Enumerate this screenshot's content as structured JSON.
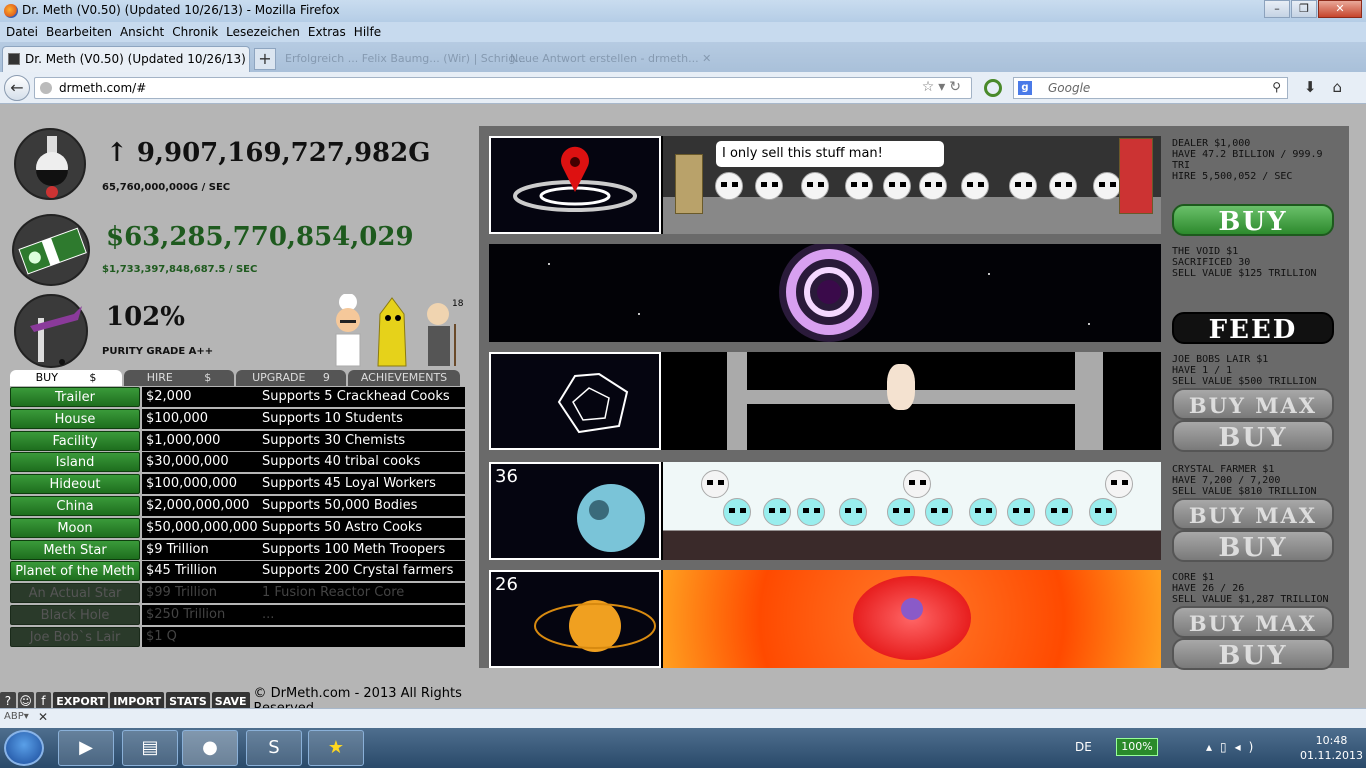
{
  "window": {
    "title": "Dr. Meth (V0.50) (Updated 10/26/13) - Mozilla Firefox",
    "controls": [
      "–",
      "❐",
      "✕"
    ]
  },
  "menu": [
    "Datei",
    "Bearbeiten",
    "Ansicht",
    "Chronik",
    "Lesezeichen",
    "Extras",
    "Hilfe"
  ],
  "tab": {
    "title": "Dr. Meth (V0.50) (Updated 10/26/13)",
    "new": "+"
  },
  "bg_tabs": [
    "Erfolgreich ... Felix Baumg... (Wir) | Schrig...",
    "Neue Antwort erstellen - drmeth... ✕"
  ],
  "nav": {
    "url": "drmeth.com/#",
    "search_placeholder": "Google",
    "search_engine": "g"
  },
  "stats": {
    "meth": "↑ 9,907,169,727,982G",
    "meth_rate": "65,760,000,000G / SEC",
    "cash": "$63,285,770,854,029",
    "cash_rate": "$1,733,397,848,687.5 / SEC",
    "purity": "102%",
    "purity_grade": "PURITY GRADE A++",
    "badge": "18"
  },
  "shop_tabs": [
    "BUY",
    "$",
    "HIRE",
    "$",
    "UPGRADE",
    "9",
    "ACHIEVEMENTS"
  ],
  "shop": [
    {
      "name": "Trailer",
      "cost": "$2,000",
      "desc": "Supports 5 Crackhead Cooks"
    },
    {
      "name": "House",
      "cost": "$100,000",
      "desc": "Supports 10 Students"
    },
    {
      "name": "Facility",
      "cost": "$1,000,000",
      "desc": "Supports 30 Chemists"
    },
    {
      "name": "Island",
      "cost": "$30,000,000",
      "desc": "Supports 40 tribal cooks"
    },
    {
      "name": "Hideout",
      "cost": "$100,000,000",
      "desc": "Supports 45 Loyal Workers"
    },
    {
      "name": "China",
      "cost": "$2,000,000,000",
      "desc": "Supports 50,000 Bodies"
    },
    {
      "name": "Moon",
      "cost": "$50,000,000,000",
      "desc": "Supports 50 Astro Cooks"
    },
    {
      "name": "Meth Star",
      "cost": "$9 Trillion",
      "desc": "Supports 100 Meth Troopers"
    },
    {
      "name": "Planet of the Meth",
      "cost": "$45 Trillion",
      "desc": "Supports 200 Crystal farmers"
    },
    {
      "name": "An Actual Star",
      "cost": "$99 Trillion",
      "desc": "1 Fusion Reactor Core"
    },
    {
      "name": "Black Hole",
      "cost": "$250 Trillion",
      "desc": "..."
    },
    {
      "name": "Joe Bob`s Lair",
      "cost": "$1 Q",
      "desc": ""
    }
  ],
  "lanes": [
    {
      "info": [
        "DEALER $1,000",
        "HAVE 47.2 BILLION / 999.9 TRI",
        "HIRE 5,500,052 / SEC"
      ],
      "btn": "BUY",
      "bubble": "I only sell this stuff man!"
    },
    {
      "info": [
        "THE VOID $1",
        "SACRIFICED 30",
        "SELL VALUE $125 TRILLION"
      ],
      "btn": "FEED"
    },
    {
      "info": [
        "JOE BOBS LAIR $1",
        "HAVE 1 / 1",
        "SELL VALUE $500 TRILLION"
      ],
      "btn1": "BUY MAX",
      "btn2": "BUY"
    },
    {
      "info": [
        "CRYSTAL FARMER $1",
        "HAVE 7,200 / 7,200",
        "SELL VALUE $810 TRILLION"
      ],
      "btn1": "BUY MAX",
      "btn2": "BUY",
      "count": "36"
    },
    {
      "info": [
        "CORE $1",
        "HAVE 26 / 26",
        "SELL VALUE $1,287 TRILLION"
      ],
      "btn1": "BUY MAX",
      "btn2": "BUY",
      "count": "26"
    }
  ],
  "footer": {
    "icons": [
      "?",
      "☺",
      "f"
    ],
    "export": "EXPORT",
    "import": "IMPORT",
    "stats": "STATS",
    "save": "SAVE",
    "copyright": "© DrMeth.com - 2013 All Rights Reserved"
  },
  "taskbar": {
    "lang": "DE",
    "battery": "100%",
    "time": "10:48",
    "date": "01.11.2013"
  }
}
